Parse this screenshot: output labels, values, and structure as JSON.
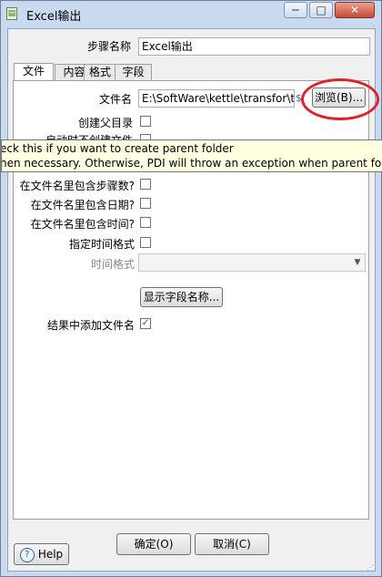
{
  "window": {
    "title": "Excel输出",
    "minimize": "─",
    "maximize": "□",
    "close": "✕"
  },
  "step": {
    "label": "步骤名称",
    "value": "Excel输出"
  },
  "tabs": [
    {
      "label": "文件"
    },
    {
      "label": "内容"
    },
    {
      "label": "格式"
    },
    {
      "label": "字段"
    }
  ],
  "file": {
    "filename_label": "文件名",
    "filename_value": "E:\\SoftWare\\kettle\\transfor\\t",
    "browse_button": "浏览(B)...",
    "create_parent_label": "创建父目录",
    "create_parent_checked": false,
    "partial_label": "启动时不创建文件",
    "include_stepnr_label": "在文件名里包含步骤数?",
    "include_date_label": "在文件名里包含日期?",
    "include_time_label": "在文件名里包含时间?",
    "specify_format_label": "指定时间格式",
    "date_format_label": "时间格式",
    "date_format_value": "",
    "show_fields_button": "显示字段名称...",
    "add_to_result_label": "结果中添加文件名",
    "add_to_result_checked": true,
    "checkmark": "✓"
  },
  "tooltip": {
    "line1": "eck this if you want to create parent folder",
    "line2": "hen necessary. Otherwise, PDI will throw an exception when parent folde"
  },
  "footer": {
    "ok_button": "确定(O)",
    "cancel_button": "取消(C)",
    "help_button": "Help",
    "help_icon": "?"
  },
  "colors": {
    "annotation_circle": "#e0202a",
    "tooltip_bg": "#ffffe1"
  }
}
